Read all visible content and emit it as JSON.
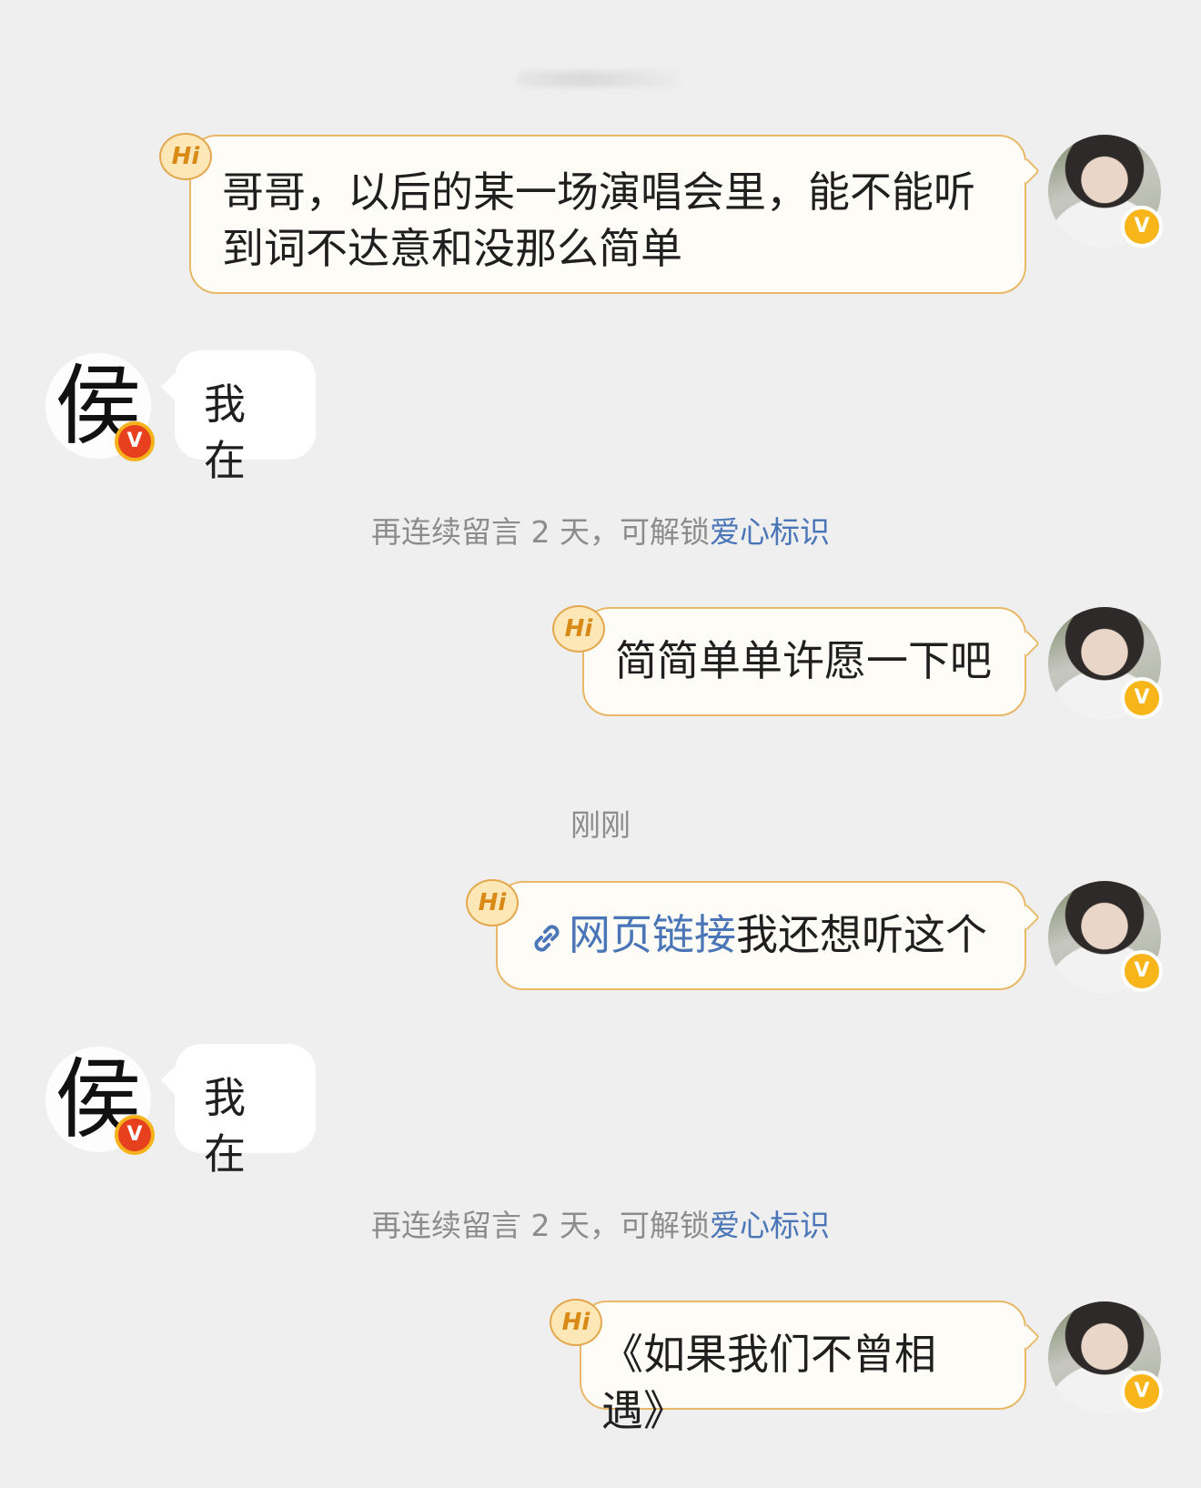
{
  "messages": [
    {
      "side": "out",
      "text": "哥哥，以后的某一场演唱会里，能不能听到词不达意和没那么简单",
      "badge": "Hi"
    },
    {
      "side": "in",
      "text": "我在",
      "avatar_char": "侯"
    },
    {
      "side": "system",
      "prefix": "再连续留言 2 天，可解锁",
      "link": "爱心标识"
    },
    {
      "side": "out",
      "text": "简简单单许愿一下吧",
      "badge": "Hi"
    },
    {
      "side": "time",
      "text": "刚刚"
    },
    {
      "side": "out",
      "link_label": "网页链接",
      "text": "我还想听这个",
      "badge": "Hi"
    },
    {
      "side": "in",
      "text": "我在",
      "avatar_char": "侯"
    },
    {
      "side": "system",
      "prefix": "再连续留言 2 天，可解锁",
      "link": "爱心标识"
    },
    {
      "side": "out",
      "text": "《如果我们不曾相遇》",
      "badge": "Hi"
    }
  ],
  "verified_mark": "V",
  "colors": {
    "background": "#efefef",
    "bubble_out_border": "#e8b866",
    "link": "#4a76b8",
    "system_text": "#8c8c8c"
  },
  "icons": {
    "link": "link-icon"
  }
}
